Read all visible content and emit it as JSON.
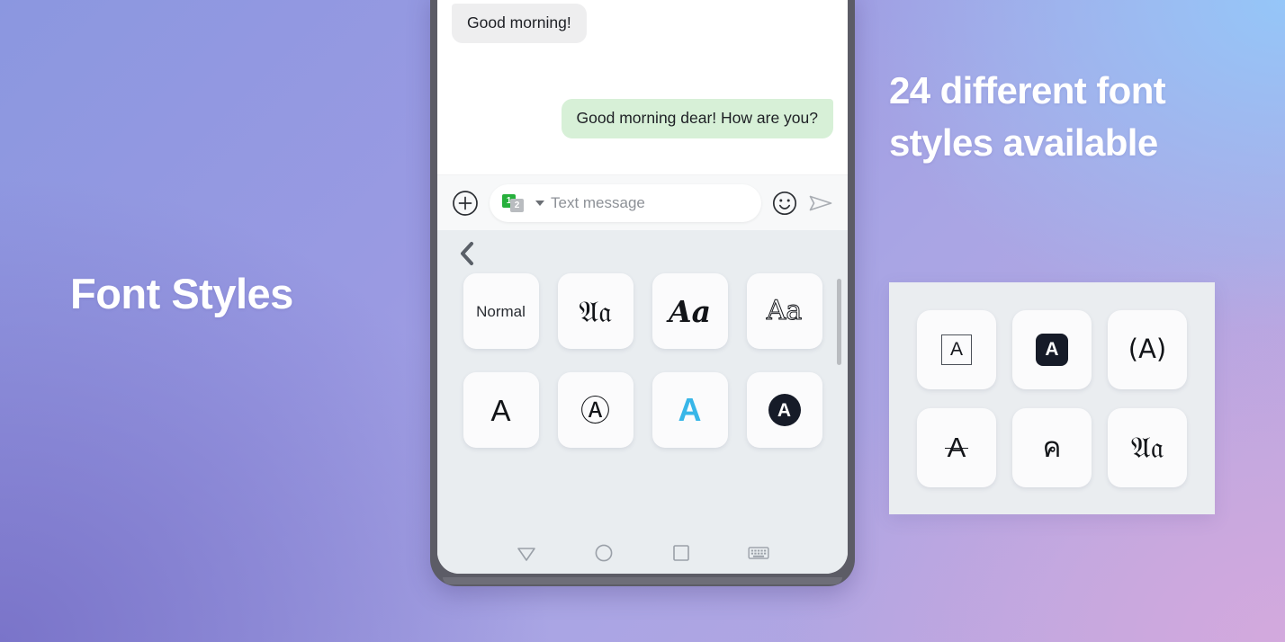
{
  "background": {
    "gradient_from": "#8b97e0",
    "gradient_to": "#d3a9dd",
    "sky_blue": "#95c6f8",
    "purple": "#7a74c9"
  },
  "left": {
    "title": "Font Styles"
  },
  "right": {
    "headline": "24 different font styles available",
    "panel_bg": "#eaedf0",
    "tiles": [
      {
        "name": "boxed-a",
        "glyph": "A",
        "style": "box-a"
      },
      {
        "name": "filled-square-a",
        "glyph": "A",
        "style": "dark-square"
      },
      {
        "name": "parenthesized-a",
        "glyph": "(A)",
        "style": "paren"
      },
      {
        "name": "struck-a",
        "glyph": "A",
        "style": "strike"
      },
      {
        "name": "thai-kho",
        "glyph": "ค",
        "style": "thai"
      },
      {
        "name": "fraktur-aa",
        "glyph": "𝔄𝔞",
        "style": "serif"
      }
    ]
  },
  "phone": {
    "conversation": {
      "incoming": "Good morning!",
      "outgoing": "Good morning dear! How are you?"
    },
    "inputbar": {
      "plus_icon": "plus-circle-icon",
      "sim_one": "1",
      "sim_two": "2",
      "placeholder": "Text message",
      "emoji_icon": "smiley-icon",
      "send_icon": "send-icon",
      "accent_sim1": "#27b03c",
      "accent_sim2": "#b9bcc0"
    },
    "fontpanel": {
      "back_icon": "chevron-left-icon",
      "bg": "#e9edf0",
      "tiles": [
        {
          "name": "normal",
          "glyph": "Normal",
          "style": "normal"
        },
        {
          "name": "fraktur-aa",
          "glyph": "𝔄𝔞",
          "style": "serif"
        },
        {
          "name": "script-aa",
          "glyph": "Aa",
          "style": "script"
        },
        {
          "name": "outline-aa",
          "glyph": "Aa",
          "style": "outline"
        },
        {
          "name": "plain-a",
          "glyph": "A",
          "style": "big"
        },
        {
          "name": "circled-a",
          "glyph": "Ⓐ",
          "style": "big"
        },
        {
          "name": "blue-bold-a",
          "glyph": "A",
          "style": "blue"
        },
        {
          "name": "dark-circle-a",
          "glyph": "A",
          "style": "dark-circle"
        }
      ]
    },
    "navbar": {
      "back": "back-triangle-icon",
      "home": "home-circle-icon",
      "recents": "recents-square-icon",
      "keyboard": "keyboard-icon"
    }
  }
}
